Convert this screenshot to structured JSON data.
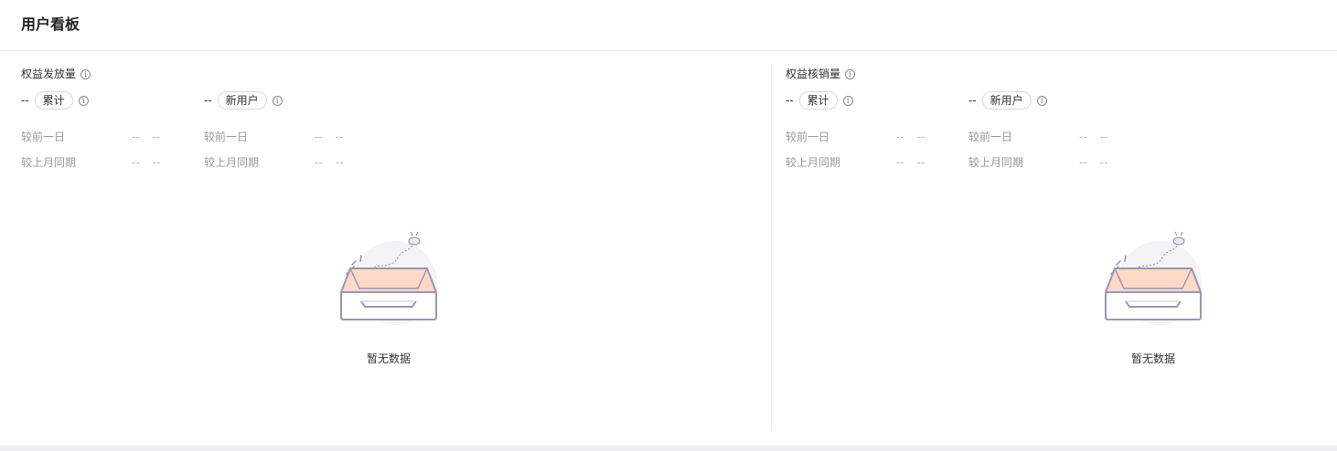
{
  "header": {
    "title": "用户看板"
  },
  "panels": [
    {
      "title": "权益发放量",
      "metrics": [
        {
          "value": "--",
          "tag": "累计",
          "compare": [
            {
              "label": "较前一日",
              "v1": "--",
              "v2": "--"
            },
            {
              "label": "较上月同期",
              "v1": "--",
              "v2": "--"
            }
          ]
        },
        {
          "value": "--",
          "tag": "新用户",
          "compare": [
            {
              "label": "较前一日",
              "v1": "--",
              "v2": "--"
            },
            {
              "label": "较上月同期",
              "v1": "--",
              "v2": "--"
            }
          ]
        }
      ],
      "empty_text": "暂无数据"
    },
    {
      "title": "权益核销量",
      "metrics": [
        {
          "value": "--",
          "tag": "累计",
          "compare": [
            {
              "label": "较前一日",
              "v1": "--",
              "v2": "--"
            },
            {
              "label": "较上月同期",
              "v1": "--",
              "v2": "--"
            }
          ]
        },
        {
          "value": "--",
          "tag": "新用户",
          "compare": [
            {
              "label": "较前一日",
              "v1": "--",
              "v2": "--"
            },
            {
              "label": "较上月同期",
              "v1": "--",
              "v2": "--"
            }
          ]
        }
      ],
      "empty_text": "暂无数据"
    }
  ],
  "icons": {
    "info": "info-icon",
    "empty": "empty-box-icon"
  },
  "colors": {
    "accent_box": "#ffd9c7",
    "box_stroke": "#9b95b5",
    "divider": "#ececec"
  }
}
